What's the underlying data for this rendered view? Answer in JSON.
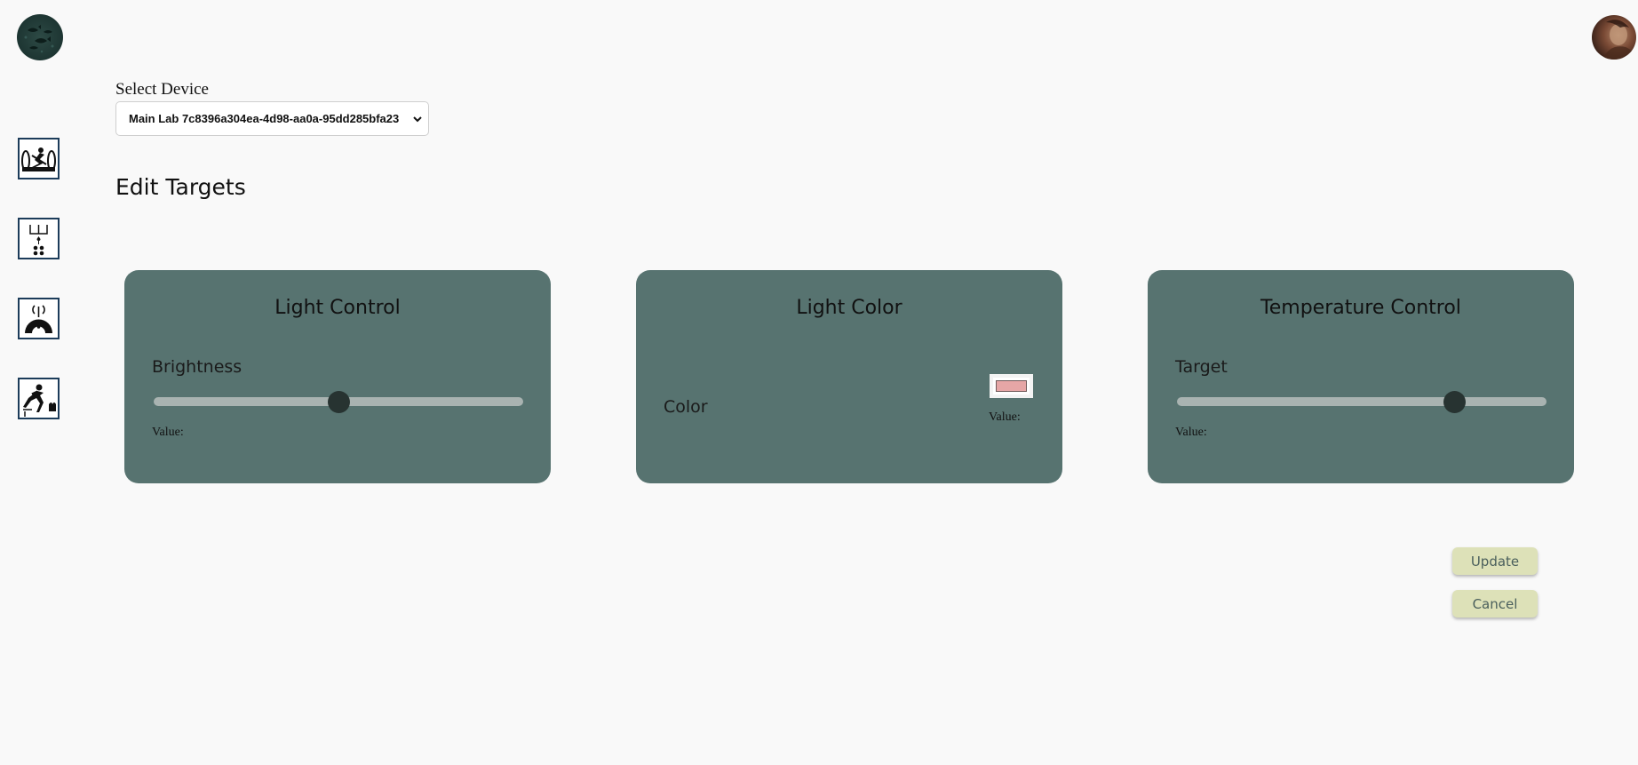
{
  "select_device": {
    "label": "Select Device",
    "selected_value": "Main Lab 7c8396a304ea-4d98-aa0a-95dd285bfa23"
  },
  "page_title": "Edit Targets",
  "cards": {
    "light_control": {
      "title": "Light Control",
      "field_label": "Brightness",
      "value_label": "Value:",
      "slider_fraction": 0.5
    },
    "light_color": {
      "title": "Light Color",
      "field_label": "Color",
      "value_label": "Value:",
      "color": "#e6a6a6"
    },
    "temperature_control": {
      "title": "Temperature Control",
      "field_label": "Target",
      "value_label": "Value:",
      "slider_fraction": 0.75
    }
  },
  "buttons": {
    "update_label": "Update",
    "cancel_label": "Cancel"
  },
  "icons": {
    "logo": "fish-logo-icon",
    "avatar": "user-avatar",
    "sidebar": [
      "rowing-icon",
      "soil-moisture-icon",
      "lamp-icon",
      "gardener-icon"
    ]
  },
  "colors": {
    "background": "#f9f9f9",
    "card": "#577370",
    "button": "#dde1b8",
    "slider_track": "#a9b3b1",
    "slider_thumb": "#273331",
    "sidebar_border": "#1c3c5a"
  }
}
